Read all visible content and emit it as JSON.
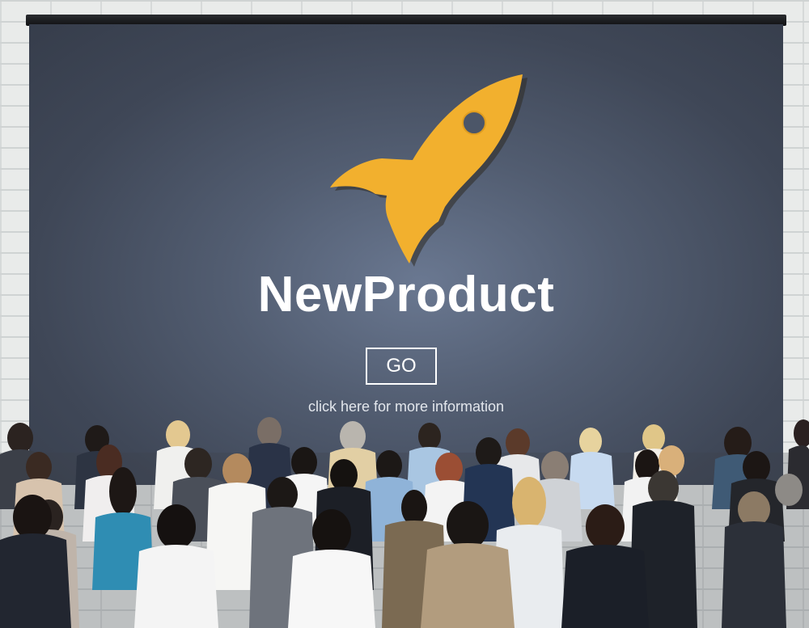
{
  "slide": {
    "headline": "NewProduct",
    "go_label": "GO",
    "info_text": "click here for more information",
    "rocket_icon": "rocket-icon",
    "rocket_color": "#f2b02e",
    "screen_color": "#4a5466"
  },
  "scene": {
    "background": "white brick wall",
    "audience": "seated business audience viewed from behind"
  }
}
